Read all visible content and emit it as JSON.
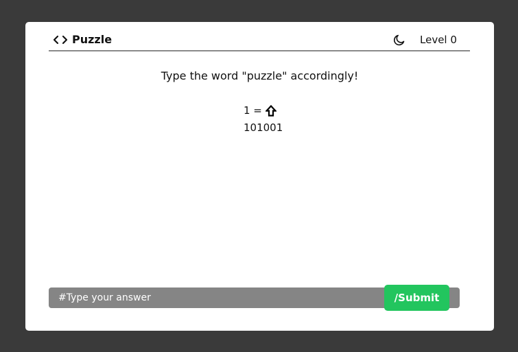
{
  "header": {
    "brand_icon": "code-brackets-icon",
    "brand_label": "Puzzle",
    "theme_icon": "moon-icon",
    "level_label": "Level 0"
  },
  "puzzle": {
    "instruction": "Type the word \"puzzle\" accordingly!",
    "legend_key": "1 =",
    "legend_icon": "arrow-up-outline-icon",
    "code": "101001"
  },
  "answer": {
    "placeholder": "#Type your answer",
    "value": "",
    "submit_label": "/Submit"
  },
  "colors": {
    "background": "#3a3a3a",
    "card": "#ffffff",
    "divider": "#8a8a8a",
    "input_bar": "#858585",
    "submit": "#22c55e"
  }
}
